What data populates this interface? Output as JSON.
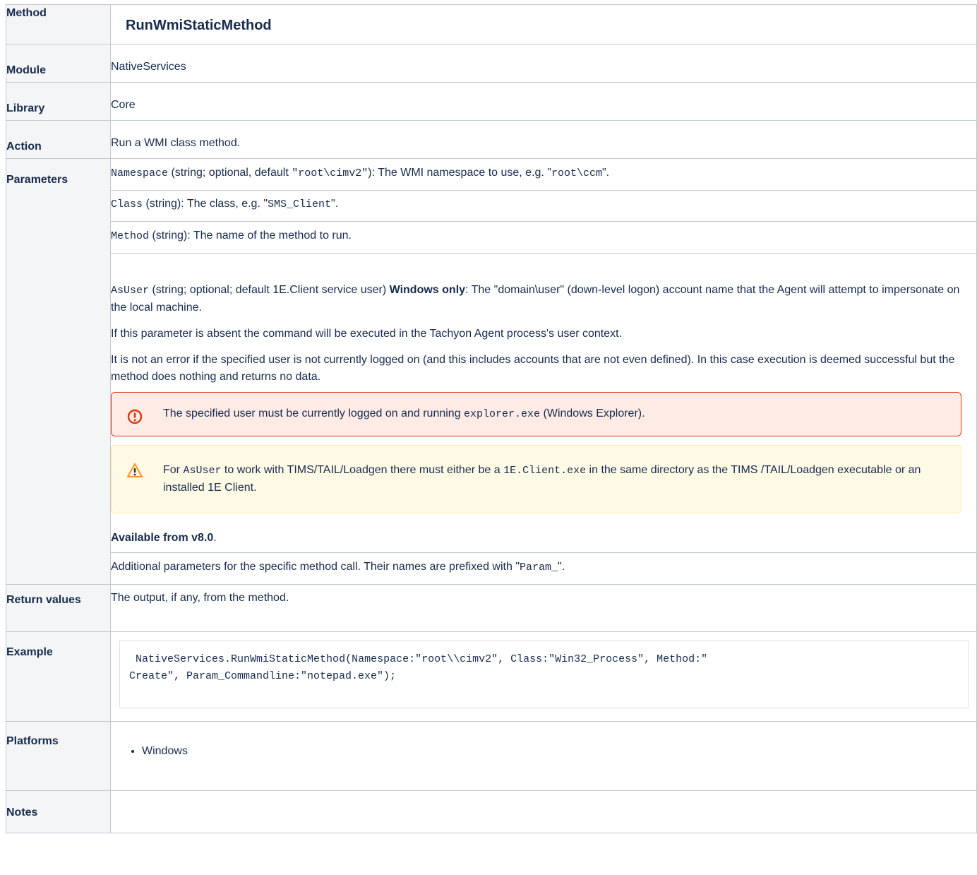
{
  "rows": {
    "method": {
      "label": "Method",
      "value": "RunWmiStaticMethod"
    },
    "module": {
      "label": "Module",
      "value": "NativeServices"
    },
    "library": {
      "label": "Library",
      "value": "Core"
    },
    "action": {
      "label": "Action",
      "value": "Run a WMI class method."
    },
    "parameters": {
      "label": "Parameters"
    },
    "return_values": {
      "label": "Return values",
      "value": "The output, if any, from the method."
    },
    "example": {
      "label": "Example",
      "code_line1": " NativeServices.RunWmiStaticMethod(Namespace:\"root\\\\cimv2\", Class:\"Win32_Process\", Method:\"",
      "code_line2": "Create\", Param_Commandline:\"notepad.exe\");"
    },
    "platforms": {
      "label": "Platforms",
      "items": [
        "Windows"
      ]
    },
    "notes": {
      "label": "Notes"
    }
  },
  "params": {
    "namespace": {
      "name": "Namespace",
      "desc_a": " (string; optional, default ",
      "default": "\"root\\cimv2\"",
      "desc_b": "): The WMI namespace to use, e.g. \"",
      "example": "root\\ccm",
      "desc_c": "\"."
    },
    "class": {
      "name": "Class",
      "desc_a": " (string): The class, e.g. \"",
      "example": "SMS_Client",
      "desc_b": "\"."
    },
    "method": {
      "name": "Method",
      "desc": " (string): The name of the method to run."
    },
    "asuser": {
      "name": "AsUser",
      "desc_a": " (string; optional; default 1E.Client service user) ",
      "bold": "Windows only",
      "desc_b": ": The \"domain\\user\" (down-level logon) account name that the Agent will attempt to impersonate on the local machine.",
      "p2": "If this parameter is absent the command will be executed in the Tachyon Agent process's user context.",
      "p3": "It is not an error if the specified user is not currently logged on (and this includes accounts that are not even defined). In this case execution is deemed successful but the method does nothing and returns no data.",
      "error_panel": {
        "text_a": "The specified user must be currently logged on and running ",
        "code": "explorer.exe",
        "text_b": " (Windows Explorer).",
        "icon": "error-icon",
        "color": "#de350b"
      },
      "warning_panel": {
        "text_a": "For ",
        "code1": "AsUser",
        "text_b": " to work with TIMS/TAIL/Loadgen there must either be a ",
        "code2": "1E.Client.exe",
        "text_c": " in the same directory as the TIMS /TAIL/Loadgen executable or an installed 1E Client.",
        "icon": "warning-icon",
        "color": "#ff991f"
      },
      "available_bold": "Available from v8.0",
      "available_tail": "."
    },
    "additional": {
      "desc_a": "Additional parameters for the specific method call. Their names are prefixed with \"",
      "code": "Param_",
      "desc_b": "\"."
    }
  }
}
